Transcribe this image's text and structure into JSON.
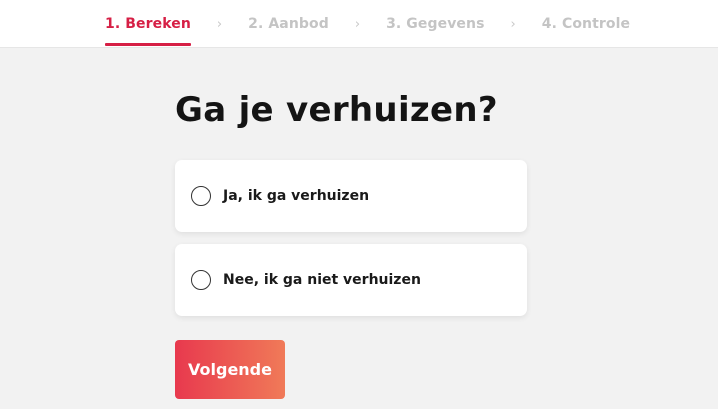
{
  "stepper": {
    "steps": [
      {
        "label": "1. Bereken",
        "active": true
      },
      {
        "label": "2. Aanbod",
        "active": false
      },
      {
        "label": "3. Gegevens",
        "active": false
      },
      {
        "label": "4. Controle",
        "active": false
      }
    ],
    "separator": "›"
  },
  "question": {
    "title": "Ga je verhuizen?",
    "options": [
      {
        "label": "Ja, ik ga verhuizen",
        "selected": false
      },
      {
        "label": "Nee, ik ga niet verhuizen",
        "selected": false
      }
    ]
  },
  "actions": {
    "next_label": "Volgende"
  },
  "colors": {
    "accent": "#d61f45",
    "button_gradient_start": "#e8394e",
    "button_gradient_end": "#f07a58",
    "inactive_step": "#c4c4c4",
    "background": "#f2f2f2"
  }
}
